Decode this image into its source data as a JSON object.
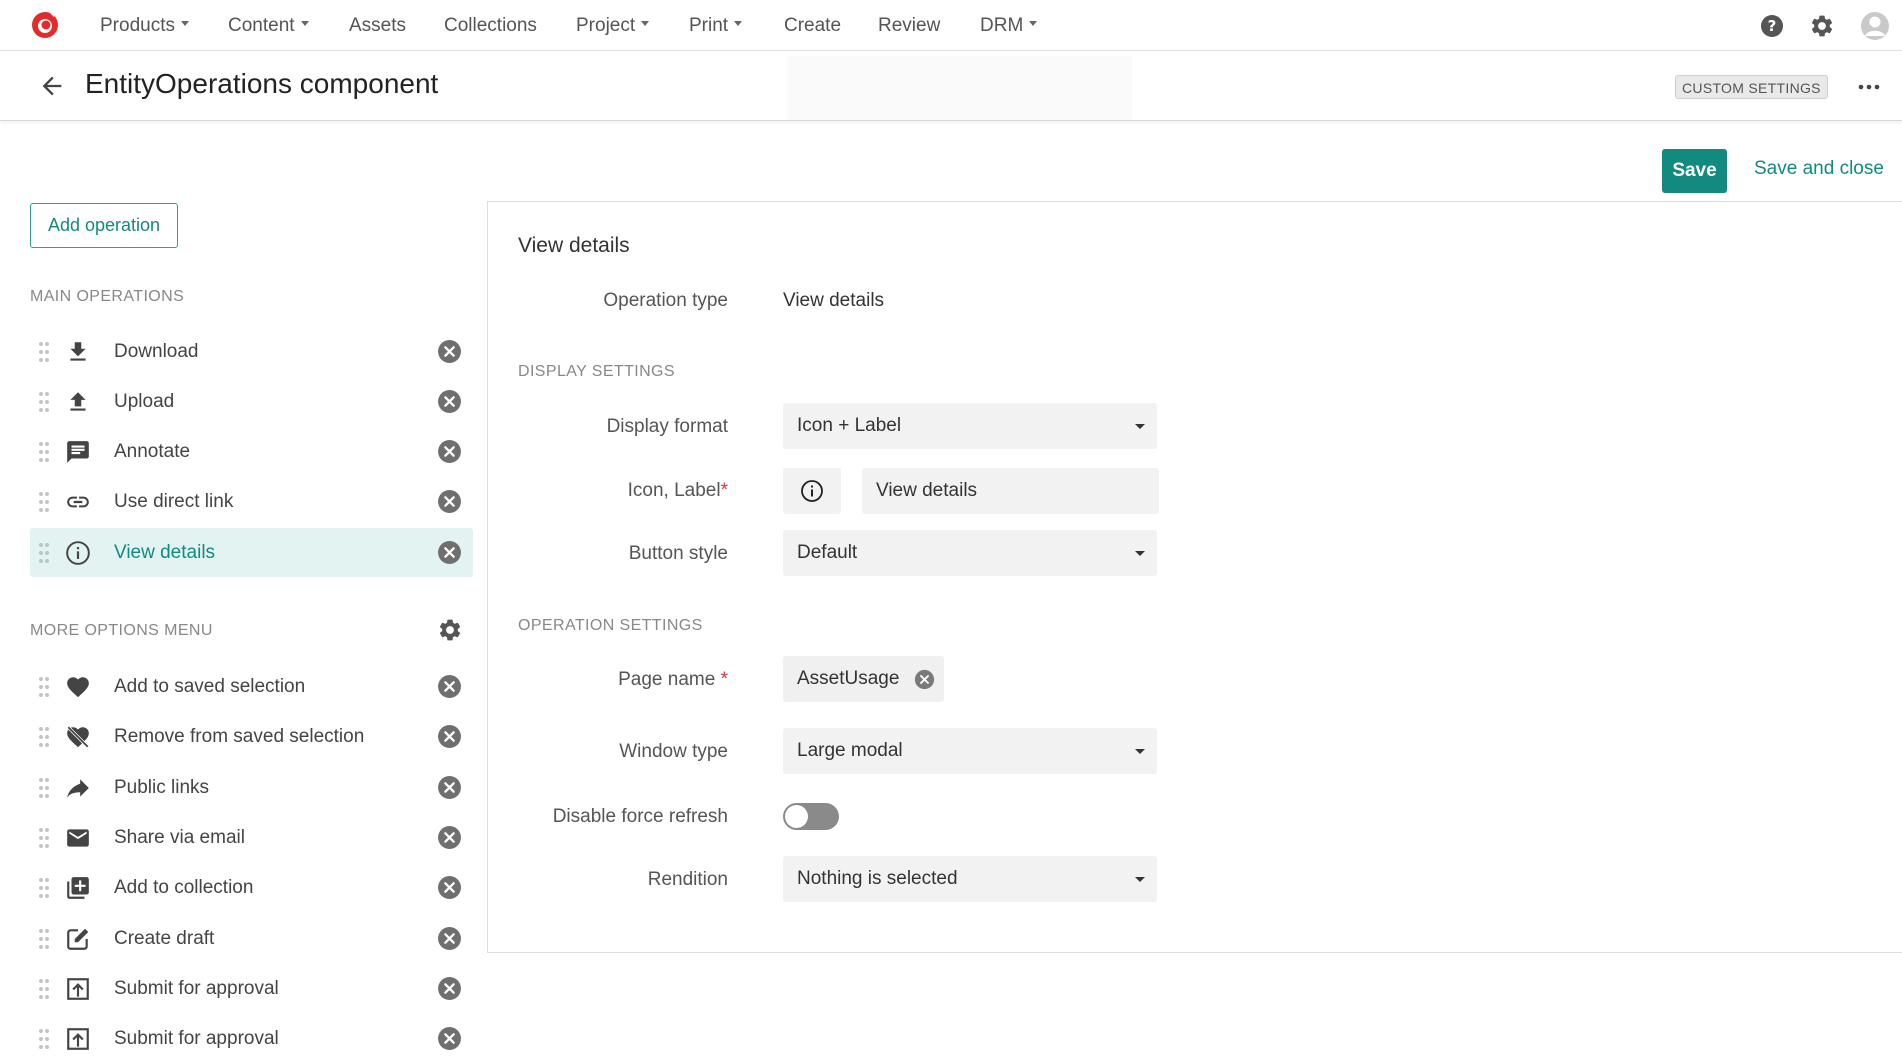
{
  "nav": {
    "items": [
      {
        "label": "Products",
        "dropdown": true
      },
      {
        "label": "Content",
        "dropdown": true
      },
      {
        "label": "Assets",
        "dropdown": false
      },
      {
        "label": "Collections",
        "dropdown": false
      },
      {
        "label": "Project",
        "dropdown": true
      },
      {
        "label": "Print",
        "dropdown": true
      },
      {
        "label": "Create",
        "dropdown": false
      },
      {
        "label": "Review",
        "dropdown": false
      },
      {
        "label": "DRM",
        "dropdown": true
      }
    ],
    "right_icons": [
      "help-icon",
      "gear-icon",
      "user-avatar-icon"
    ],
    "brand_color": "#e32b2b"
  },
  "header": {
    "title": "EntityOperations component",
    "badge": "CUSTOM SETTINGS"
  },
  "actions": {
    "save_label": "Save",
    "save_close_label": "Save and close",
    "accent_color": "#128a7f"
  },
  "left": {
    "add_operation_label": "Add operation",
    "main_label": "MAIN OPERATIONS",
    "main_ops": [
      {
        "label": "Download",
        "icon": "download-icon",
        "selected": false
      },
      {
        "label": "Upload",
        "icon": "upload-icon",
        "selected": false
      },
      {
        "label": "Annotate",
        "icon": "comment-icon",
        "selected": false
      },
      {
        "label": "Use direct link",
        "icon": "link-icon",
        "selected": false
      },
      {
        "label": "View details",
        "icon": "info-icon",
        "selected": true
      }
    ],
    "more_label": "MORE OPTIONS MENU",
    "more_ops": [
      {
        "label": "Add to saved selection",
        "icon": "heart-icon"
      },
      {
        "label": "Remove from saved selection",
        "icon": "heart-off-icon"
      },
      {
        "label": "Public links",
        "icon": "share-arrow-icon"
      },
      {
        "label": "Share via email",
        "icon": "mail-icon"
      },
      {
        "label": "Add to collection",
        "icon": "add-collection-icon"
      },
      {
        "label": "Create draft",
        "icon": "edit-icon"
      },
      {
        "label": "Submit for approval",
        "icon": "submit-icon"
      },
      {
        "label": "Submit for approval",
        "icon": "submit-icon"
      }
    ]
  },
  "panel": {
    "title": "View details",
    "operation_type_label": "Operation type",
    "operation_type_value": "View details",
    "display_section": "DISPLAY SETTINGS",
    "display_format_label": "Display format",
    "display_format_value": "Icon + Label",
    "icon_label_label": "Icon, Label",
    "required_mark": "*",
    "icon_value": "info-icon",
    "label_value": "View details",
    "button_style_label": "Button style",
    "button_style_value": "Default",
    "operation_section": "OPERATION SETTINGS",
    "page_name_label": "Page name ",
    "page_name_value": "AssetUsage",
    "window_type_label": "Window type",
    "window_type_value": "Large modal",
    "disable_refresh_label": "Disable force refresh",
    "disable_refresh_on": false,
    "rendition_label": "Rendition",
    "rendition_value": "Nothing is selected"
  }
}
